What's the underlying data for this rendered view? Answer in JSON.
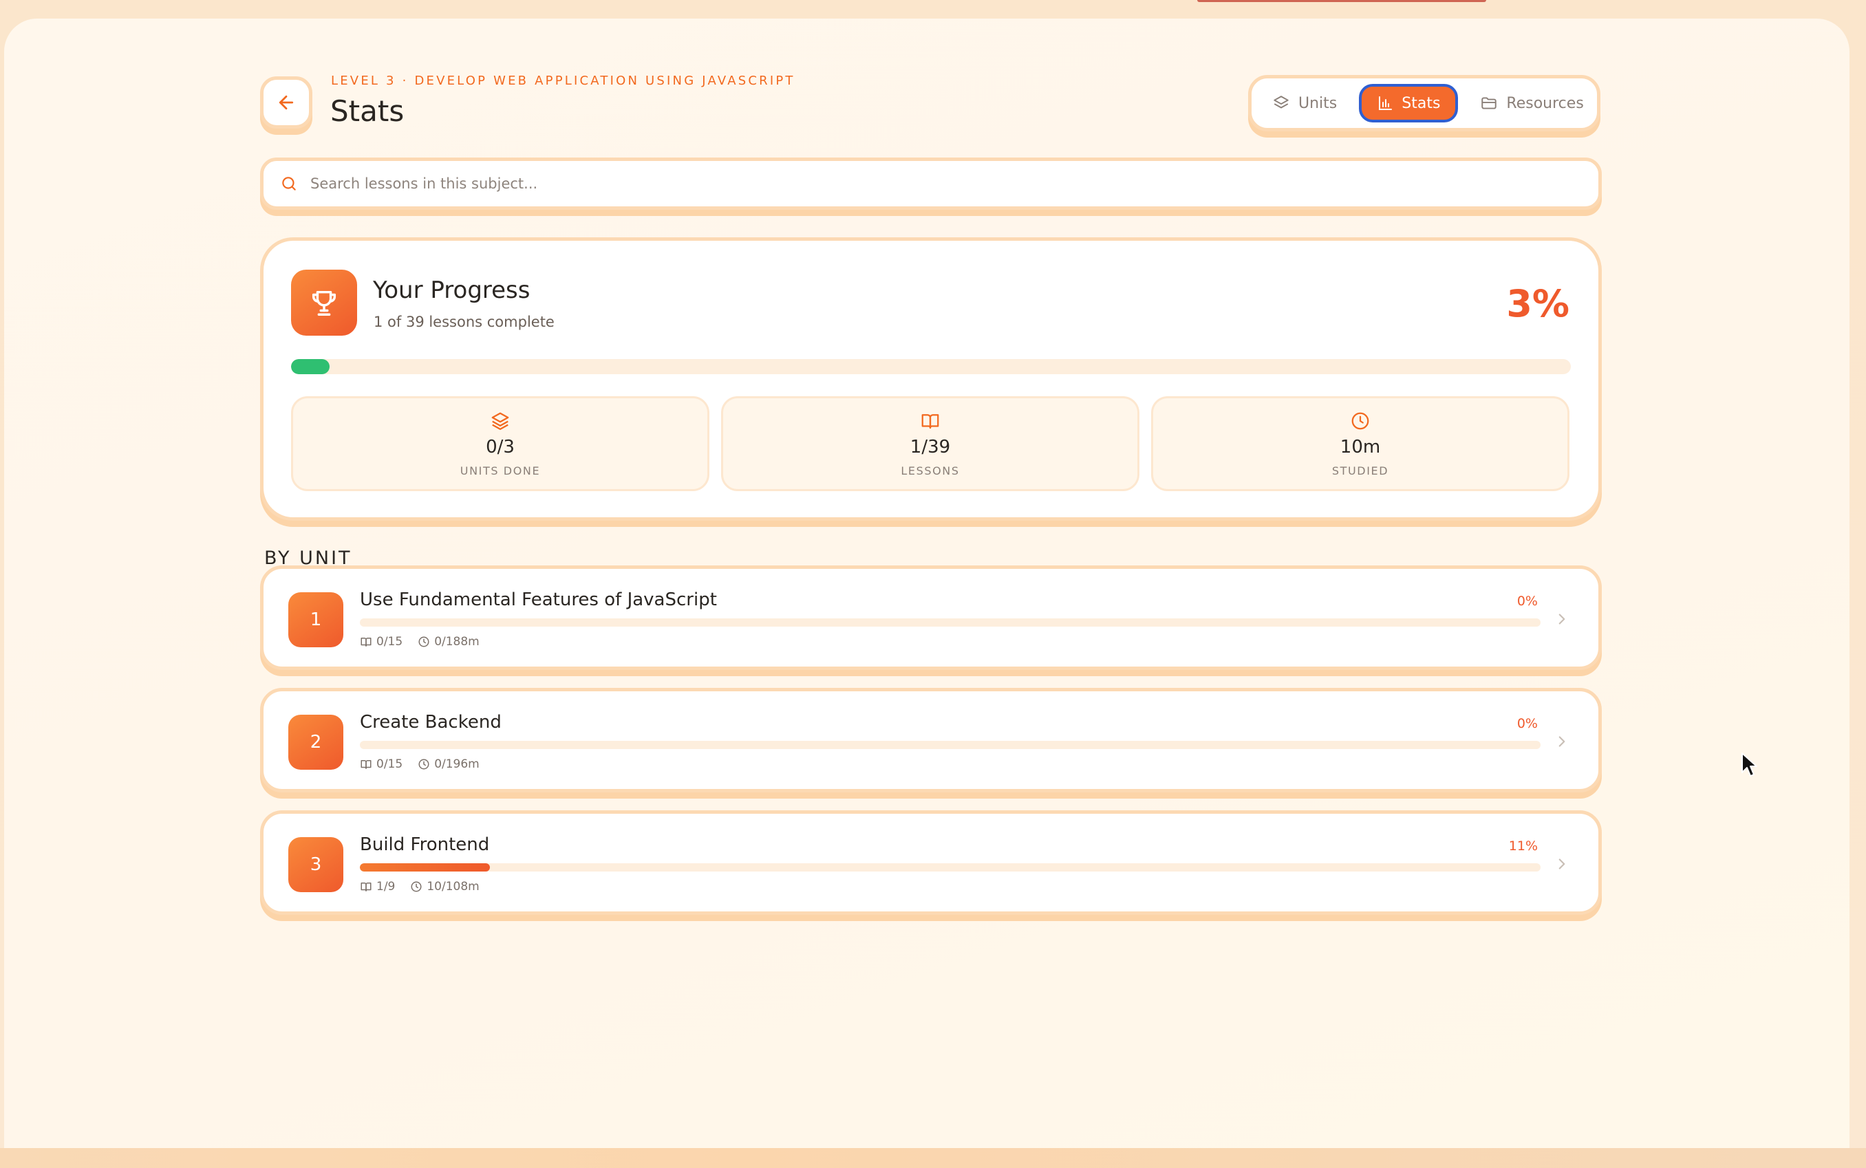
{
  "header": {
    "eyebrow": "LEVEL 3 · DEVELOP WEB APPLICATION USING JAVASCRIPT",
    "title": "Stats",
    "back_icon": "arrow-left-icon"
  },
  "tabs": [
    {
      "label": "Units",
      "icon": "layers-icon",
      "active": false
    },
    {
      "label": "Stats",
      "icon": "bar-chart-icon",
      "active": true
    },
    {
      "label": "Resources",
      "icon": "folder-icon",
      "active": false
    }
  ],
  "search": {
    "placeholder": "Search lessons in this subject...",
    "value": ""
  },
  "progress": {
    "title": "Your Progress",
    "subtitle": "1 of 39 lessons complete",
    "percent_label": "3%",
    "percent_value": 3,
    "stats": [
      {
        "value": "0/3",
        "label": "UNITS DONE",
        "icon": "layers-icon"
      },
      {
        "value": "1/39",
        "label": "LESSONS",
        "icon": "book-icon"
      },
      {
        "value": "10m",
        "label": "STUDIED",
        "icon": "clock-icon"
      }
    ]
  },
  "by_unit": {
    "heading": "BY UNIT",
    "units": [
      {
        "number": "1",
        "title": "Use Fundamental Features of JavaScript",
        "percent_label": "0%",
        "percent_value": 0,
        "lessons": "0/15",
        "minutes": "0/188m"
      },
      {
        "number": "2",
        "title": "Create Backend",
        "percent_label": "0%",
        "percent_value": 0,
        "lessons": "0/15",
        "minutes": "0/196m"
      },
      {
        "number": "3",
        "title": "Build Frontend",
        "percent_label": "11%",
        "percent_value": 11,
        "lessons": "1/9",
        "minutes": "10/108m"
      }
    ]
  },
  "colors": {
    "accent": "#ef5a2c",
    "success": "#2fbf71",
    "active_outline": "#2f5fd1",
    "card_border": "#fcd9b3"
  }
}
